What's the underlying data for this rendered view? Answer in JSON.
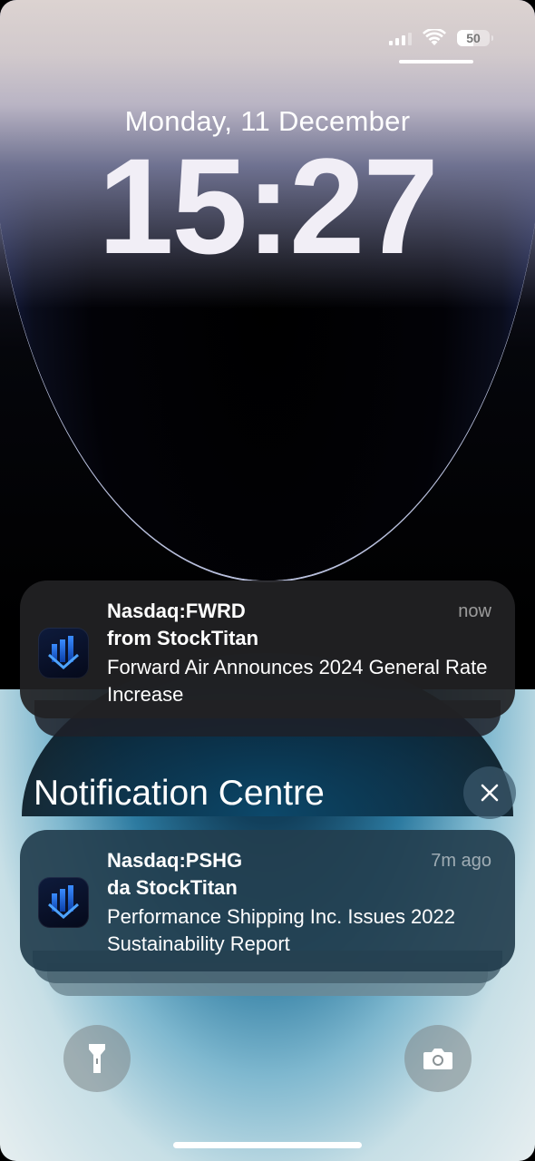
{
  "status_bar": {
    "battery_level": "50",
    "signal_icon": "cellular-signal-icon",
    "wifi_icon": "wifi-icon",
    "battery_icon": "battery-icon"
  },
  "lock_screen": {
    "date": "Monday, 11 December",
    "time": "15:27"
  },
  "notifications": [
    {
      "title": "Nasdaq:FWRD",
      "subtitle": "from StockTitan",
      "body": "Forward Air Announces 2024 General Rate Increase",
      "time": "now",
      "icon": "stocktitan-app-icon"
    }
  ],
  "notification_centre": {
    "title": "Notification Centre",
    "close_icon": "close-icon",
    "items": [
      {
        "title": "Nasdaq:PSHG",
        "subtitle": "da StockTitan",
        "body": "Performance Shipping Inc. Issues 2022 Sustainability Report",
        "time": "7m ago",
        "icon": "stocktitan-app-icon"
      }
    ]
  },
  "quick_actions": {
    "left_icon": "flashlight-icon",
    "right_icon": "camera-icon"
  },
  "colors": {
    "accent_blue": "#2f48a0",
    "notification_dark": "#222224",
    "notification_teal": "#233e4e"
  }
}
